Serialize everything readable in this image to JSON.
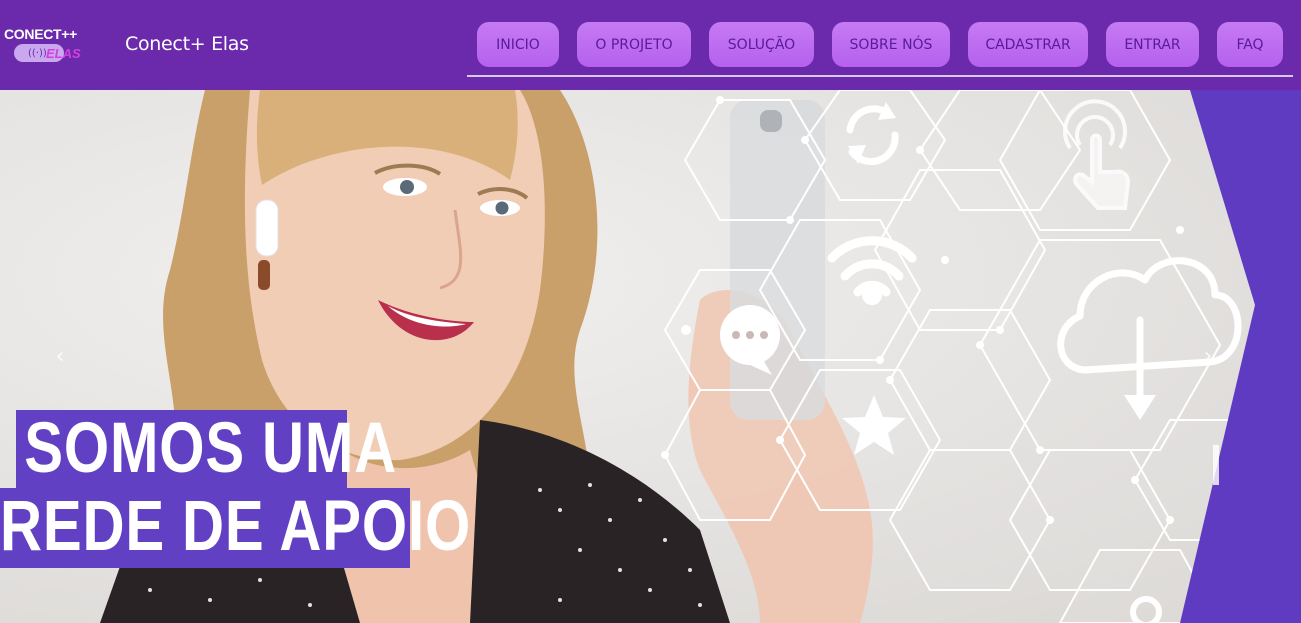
{
  "brand": {
    "logo_top": "CONECT++",
    "logo_bottom": "ELAS",
    "logo_icon": "wifi-waves-icon",
    "title": "Conect+ Elas"
  },
  "nav": {
    "items": [
      {
        "id": "inicio",
        "label": "INICIO"
      },
      {
        "id": "projeto",
        "label": "O PROJETO"
      },
      {
        "id": "solucao",
        "label": "SOLUÇÃO"
      },
      {
        "id": "sobre",
        "label": "SOBRE NÓS"
      },
      {
        "id": "cadastrar",
        "label": "CADASTRAR"
      },
      {
        "id": "entrar",
        "label": "ENTRAR"
      },
      {
        "id": "faq",
        "label": "FAQ"
      }
    ]
  },
  "hero": {
    "headline_line1": "SOMOS UMA",
    "headline_line2": "REDE DE APOIO",
    "prev_icon": "chevron-left-icon",
    "next_icon": "chevron-right-icon",
    "overlay_icons": [
      "refresh-icon",
      "touch-icon",
      "wifi-icon",
      "cloud-download-icon",
      "chat-icon",
      "star-icon",
      "location-pin-icon"
    ]
  },
  "colors": {
    "header": "#6b2aac",
    "nav_button": "#c67af3",
    "nav_text": "#5a1a9c",
    "accent_purple": "#6240c4"
  }
}
